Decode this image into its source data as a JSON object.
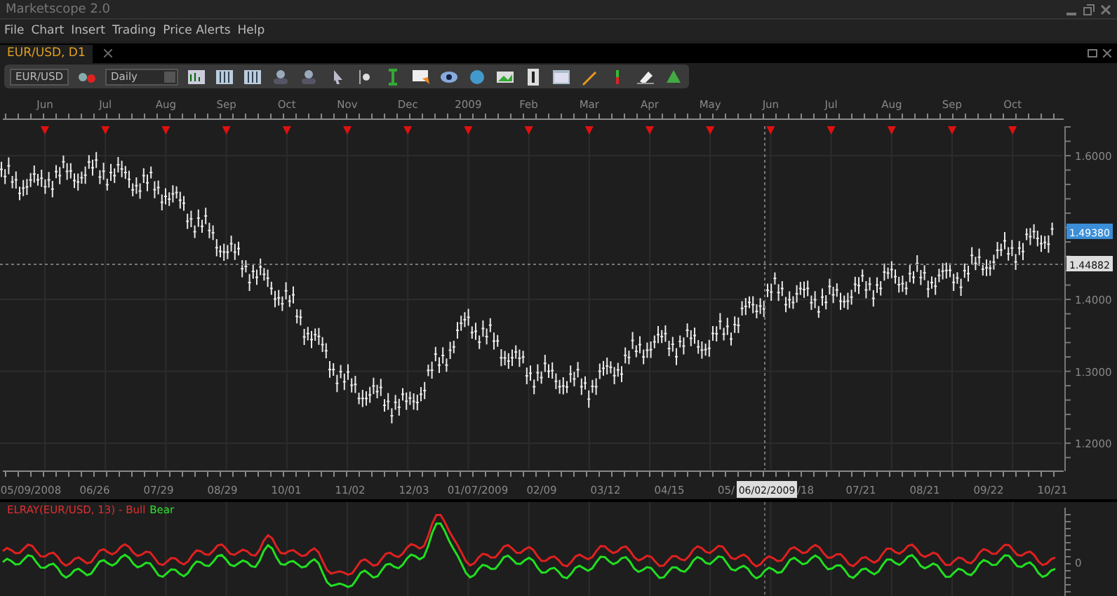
{
  "window": {
    "title": "Marketscope 2.0"
  },
  "menu": [
    "File",
    "Chart",
    "Insert",
    "Trading",
    "Price Alerts",
    "Help"
  ],
  "tabs": [
    {
      "label": "EUR/USD, D1",
      "selected": true
    }
  ],
  "toolbar": {
    "symbol": "EUR/USD",
    "period": "Daily"
  },
  "price_chart": {
    "months": [
      "Jun",
      "Jul",
      "Aug",
      "Sep",
      "Oct",
      "Nov",
      "Dec",
      "2009",
      "Feb",
      "Mar",
      "Apr",
      "May",
      "Jun",
      "Jul",
      "Aug",
      "Sep",
      "Oct"
    ],
    "price_labels": [
      "1.6000",
      "1.4000",
      "1.3000",
      "1.2000"
    ],
    "bottom_axis": [
      {
        "text": "05/09/2008"
      },
      {
        "text": "06/26"
      },
      {
        "text": "07/29"
      },
      {
        "text": "08/29"
      },
      {
        "text": "10/01"
      },
      {
        "text": "11/02"
      },
      {
        "text": "12/03"
      },
      {
        "text": "01/07/2009"
      },
      {
        "text": "02/09"
      },
      {
        "text": "03/12"
      },
      {
        "text": "04/15"
      },
      {
        "text": "05/"
      },
      {
        "text": "/18"
      },
      {
        "text": "07/21"
      },
      {
        "text": "08/21"
      },
      {
        "text": "09/22"
      },
      {
        "text": "10/21"
      }
    ],
    "current_price": "1.49380",
    "crosshair_price": "1.44882",
    "crosshair_date": "06/02/2009"
  },
  "indicator": {
    "title": "ELRAY(EUR/USD, 13) - Bull",
    "legend": "Bear",
    "ytick": "0"
  }
}
